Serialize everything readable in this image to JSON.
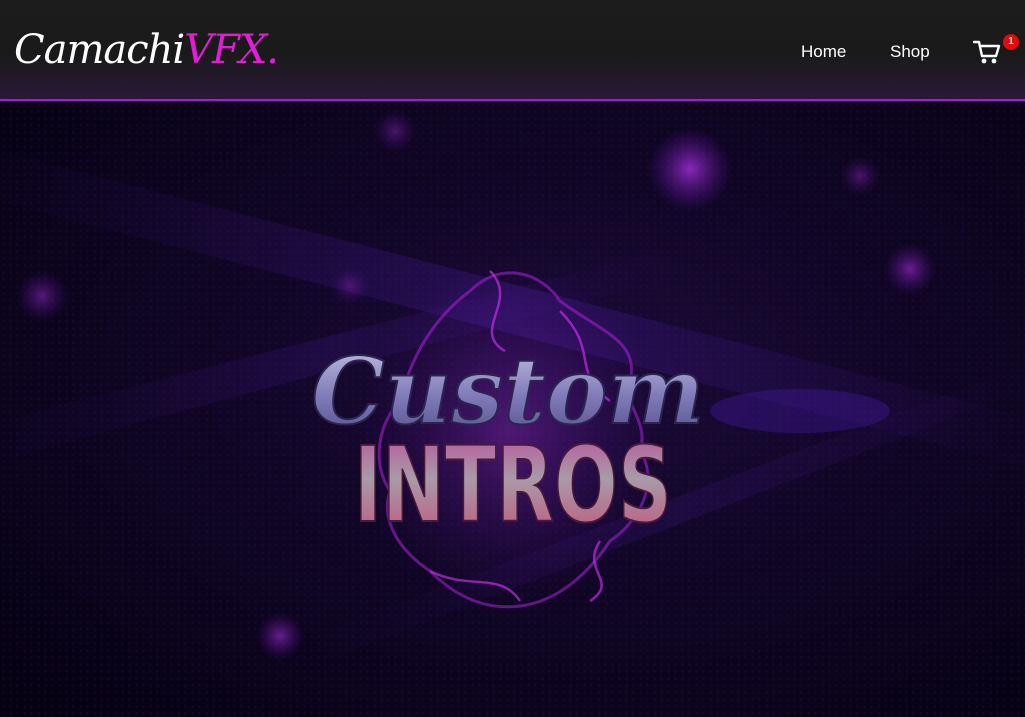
{
  "brand": {
    "name_part1": "Camachi",
    "name_part2": "VFX."
  },
  "nav": {
    "home_label": "Home",
    "shop_label": "Shop"
  },
  "cart": {
    "icon": "shopping-cart-icon",
    "count": "1"
  },
  "hero": {
    "line1": "Custom",
    "line2": "INTROS"
  },
  "colors": {
    "accent": "#e21dd8",
    "header_border": "#a51bd6",
    "badge": "#e00c0c"
  }
}
